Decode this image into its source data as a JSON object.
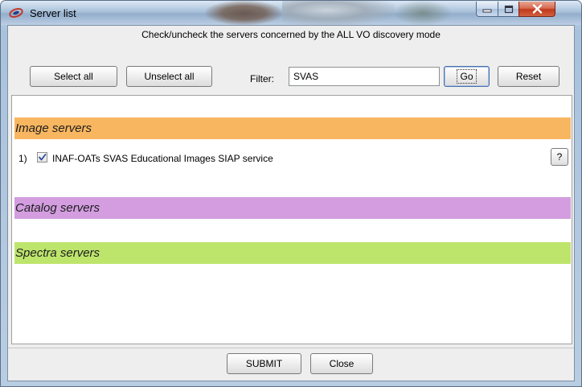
{
  "window": {
    "title": "Server list",
    "controls": {
      "minimize": "minimize-icon",
      "maximize": "maximize-icon",
      "close": "close-icon"
    }
  },
  "instruction": "Check/uncheck the servers concerned by the ALL VO discovery mode",
  "toolbar": {
    "select_all": "Select all",
    "unselect_all": "Unselect all",
    "filter_label": "Filter:",
    "filter_value": "SVAS",
    "go": "Go",
    "reset": "Reset"
  },
  "sections": [
    {
      "title": "Image servers",
      "color": "#f8b660",
      "servers": [
        {
          "index": "1)",
          "checked": true,
          "name": "INAF-OATs SVAS Educational Images SIAP service",
          "help": "?"
        }
      ]
    },
    {
      "title": "Catalog servers",
      "color": "#d39de0",
      "servers": []
    },
    {
      "title": "Spectra servers",
      "color": "#bde56c",
      "servers": []
    }
  ],
  "footer": {
    "submit": "SUBMIT",
    "close": "Close"
  }
}
